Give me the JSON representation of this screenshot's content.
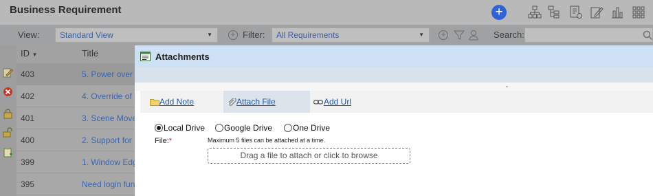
{
  "page": {
    "title": "Business Requirement",
    "add_button_glyph": "+",
    "toolbar_icons": [
      "hierarchy-icon",
      "tree-icon",
      "report-icon",
      "edit-form-icon",
      "bar-chart-icon",
      "grid-menu-icon"
    ]
  },
  "filters": {
    "view_label": "View:",
    "view_value": "Standard View",
    "filter_label": "Filter:",
    "filter_value": "All Requirements",
    "search_label": "Search:",
    "search_value": ""
  },
  "grid": {
    "columns": [
      "ID",
      "Title"
    ],
    "rows": [
      {
        "id": "403",
        "title": "5. Power over"
      },
      {
        "id": "402",
        "title": "4. Override of"
      },
      {
        "id": "401",
        "title": "3. Scene Move"
      },
      {
        "id": "400",
        "title": "2. Support for"
      },
      {
        "id": "399",
        "title": "1. Window Edg"
      },
      {
        "id": "395",
        "title": "Need login fun"
      }
    ]
  },
  "modal": {
    "title": "Attachments",
    "tabs": {
      "add_note": "Add Note",
      "attach_file": "Attach File",
      "add_url": "Add Url"
    },
    "sources": {
      "local": "Local Drive",
      "google": "Google Drive",
      "onedrive": "One Drive",
      "selected": "Local Drive"
    },
    "file_label": "File:",
    "required_mark": "*",
    "hint": "Maximum 5 files can be attached at a time.",
    "dropzone_text": "Drag a file to attach or click to browse"
  },
  "colors": {
    "accent_blue": "#2e63d8",
    "link_blue": "#1f57a6",
    "modal_header": "#cde0f4",
    "required_red": "#dd2222"
  }
}
